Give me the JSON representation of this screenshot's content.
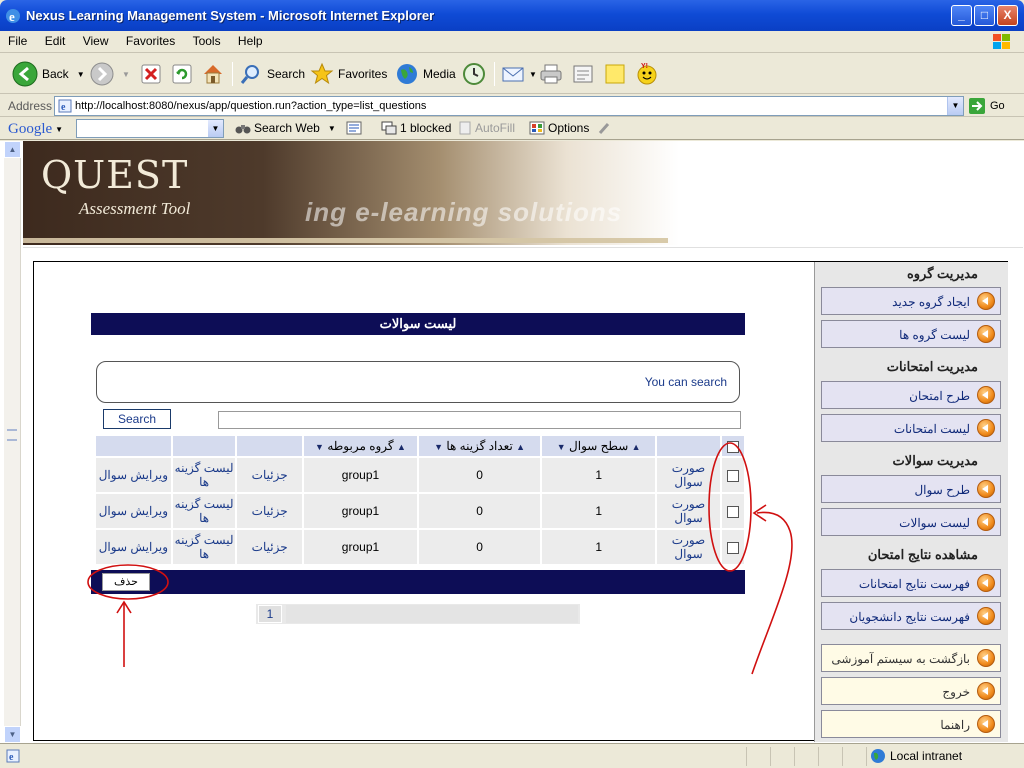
{
  "window": {
    "title": "Nexus Learning Management System - Microsoft Internet Explorer",
    "minimize": "_",
    "maximize": "□",
    "close": "X"
  },
  "menu": [
    "File",
    "Edit",
    "View",
    "Favorites",
    "Tools",
    "Help"
  ],
  "toolbar": {
    "back": "Back",
    "search": "Search",
    "favorites": "Favorites",
    "media": "Media"
  },
  "address": {
    "label": "Address",
    "url": "http://localhost:8080/nexus/app/question.run?action_type=list_questions",
    "go": "Go"
  },
  "google": {
    "brand": "Google",
    "search_web": "Search Web",
    "blocked": "1 blocked",
    "autofill": "AutoFill",
    "options": "Options"
  },
  "banner": {
    "title": "QUEST",
    "subtitle": "Assessment Tool",
    "tagline": "ing e-learning solutions"
  },
  "sidebar": {
    "group_mgmt": "مدیریت گروه",
    "create_group": "ایجاد گروه جدید",
    "group_list": "لیست گروه ها",
    "exam_mgmt": "مدیریت امتحانات",
    "design_exam": "طرح امتحان",
    "exam_list": "لیست امتحانات",
    "question_mgmt": "مدیریت سوالات",
    "design_question": "طرح سوال",
    "question_list": "لیست سوالات",
    "results_view": "مشاهده نتایج امتحان",
    "exam_results": "فهرست نتایج امتحانات",
    "student_results": "فهرست نتایج دانشجویان",
    "back_to_lms": "بازگشت به سیستم آموزشی",
    "logout": "خروج",
    "help": "راهنما"
  },
  "main": {
    "page_title": "لیست سوالات",
    "search_hint": "You can search",
    "search_button": "Search",
    "columns": [
      "",
      "",
      "سطح سوال",
      "تعداد گزینه ها",
      "گروه مربوطه",
      "",
      "",
      ""
    ],
    "rows": [
      {
        "form": "صورت سوال",
        "level": "1",
        "options": "0",
        "group": "group1",
        "details": "جزئیات",
        "option_list": "لیست گزینه ها",
        "edit": "ویرایش سوال"
      },
      {
        "form": "صورت سوال",
        "level": "1",
        "options": "0",
        "group": "group1",
        "details": "جزئیات",
        "option_list": "لیست گزینه ها",
        "edit": "ویرایش سوال"
      },
      {
        "form": "صورت سوال",
        "level": "1",
        "options": "0",
        "group": "group1",
        "details": "جزئیات",
        "option_list": "لیست گزینه ها",
        "edit": "ویرایش سوال"
      }
    ],
    "delete_button": "حذف",
    "page_number": "1"
  },
  "status": {
    "zone": "Local intranet"
  },
  "colors": {
    "title_bar": "#0f4bd6",
    "header_navy": "#0d0d56",
    "annotation_red": "#d01010",
    "link_blue": "#1a3a8a"
  }
}
